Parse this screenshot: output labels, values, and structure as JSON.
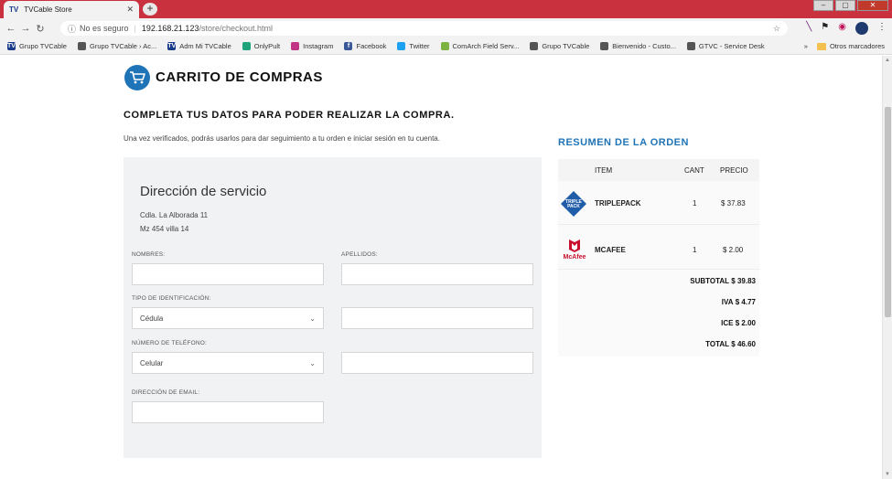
{
  "browser": {
    "tab_favicon": "TV",
    "tab_title": "TVCable Store",
    "tab_close": "✕",
    "new_tab": "+",
    "security_text": "No es seguro",
    "url_host": "192.168.21.123",
    "url_path": "/store/checkout.html",
    "bookmarks": [
      {
        "icon": "TV",
        "label": "Grupo TVCable",
        "color": "#1a3a8a"
      },
      {
        "icon": "",
        "label": "Grupo TVCable › Ac...",
        "color": "#555555"
      },
      {
        "icon": "TV",
        "label": "Adm Mi TVCable",
        "color": "#1a3a8a"
      },
      {
        "icon": "",
        "label": "OnlyPult",
        "color": "#1fa37a"
      },
      {
        "icon": "",
        "label": "Instagram",
        "color": "#c13584"
      },
      {
        "icon": "f",
        "label": "Facebook",
        "color": "#3b5998"
      },
      {
        "icon": "",
        "label": "Twitter",
        "color": "#1da1f2"
      },
      {
        "icon": "",
        "label": "ComArch Field Serv...",
        "color": "#7cb342"
      },
      {
        "icon": "",
        "label": "Grupo TVCable",
        "color": "#555555"
      },
      {
        "icon": "",
        "label": "Bienvenido - Custo...",
        "color": "#555555"
      },
      {
        "icon": "",
        "label": "GTVC - Service Desk",
        "color": "#555555"
      }
    ],
    "more_bookmarks": "»",
    "other_bookmarks": "Otros marcadores"
  },
  "page": {
    "cart_title": "CARRITO DE COMPRAS",
    "subtitle": "COMPLETA TUS DATOS PARA PODER REALIZAR LA COMPRA.",
    "intro": "Una vez verificados, podrás usarlos para dar seguimiento a tu orden e iniciar sesión en tu cuenta."
  },
  "form": {
    "title": "Dirección de servicio",
    "address_line1": "Cdla. La Alborada 11",
    "address_line2": "Mz 454 villa 14",
    "labels": {
      "nombres": "NOMBRES:",
      "apellidos": "APELLIDOS:",
      "tipo_id": "TIPO DE IDENTIFICACIÓN:",
      "telefono": "NÚMERO DE TELÉFONO:",
      "email": "DIRECCIÓN DE EMAIL:"
    },
    "tipo_id_value": "Cédula",
    "telefono_type_value": "Celular"
  },
  "summary": {
    "title": "RESUMEN DE LA ORDEN",
    "headers": {
      "item": "ITEM",
      "cant": "CANT",
      "precio": "PRECIO"
    },
    "items": [
      {
        "name": "TRIPLEPACK",
        "qty": "1",
        "price": "$ 37.83",
        "logo_text": "TRIPLE PACK"
      },
      {
        "name": "MCAFEE",
        "qty": "1",
        "price": "$ 2.00",
        "logo_text": "McAfee"
      }
    ],
    "subtotal_label": "SUBTOTAL",
    "subtotal": "$ 39.83",
    "iva_label": "IVA",
    "iva": "$ 4.77",
    "ice_label": "ICE",
    "ice": "$ 2.00",
    "total_label": "TOTAL",
    "total": "$ 46.60"
  },
  "colors": {
    "accent": "#1f74b8",
    "tabbar": "#c9313f"
  }
}
